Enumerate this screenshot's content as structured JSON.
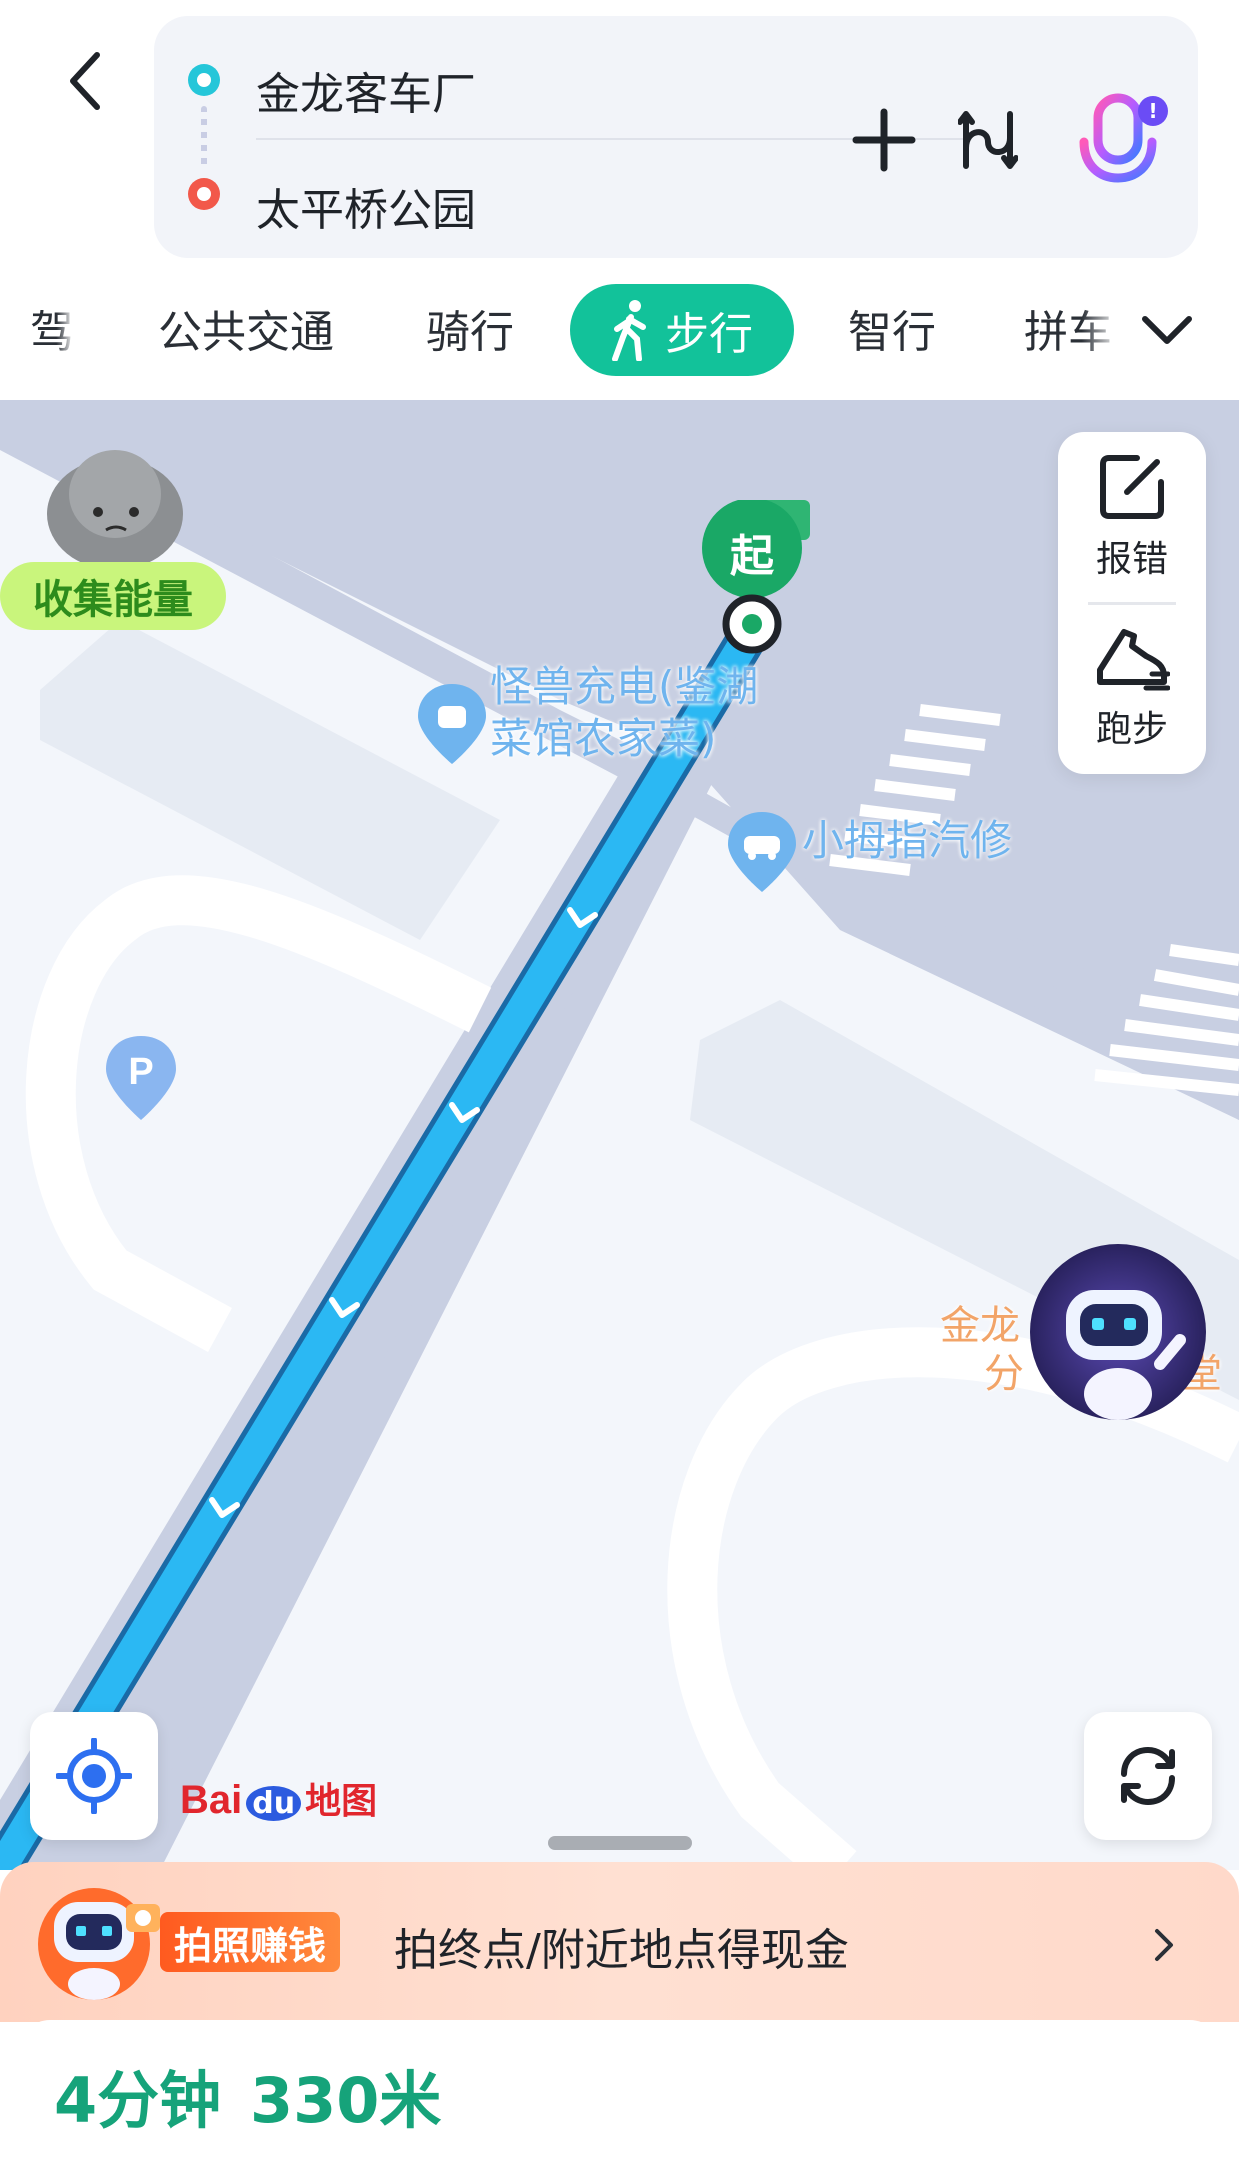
{
  "header": {
    "back_icon": "chevron-left-icon",
    "start_location": "金龙客车厂",
    "end_location": "太平桥公园",
    "add_waypoint_icon": "plus-icon",
    "swap_icon": "swap-route-icon",
    "voice_icon": "microphone-icon",
    "voice_badge": "!"
  },
  "tabs": {
    "items": [
      "驾",
      "公共交通",
      "骑行",
      "步行",
      "智行",
      "拼车"
    ],
    "active_index": 3,
    "active_icon": "walking-person-icon",
    "more_icon": "chevron-down-icon"
  },
  "map": {
    "energy_label": "收集能量",
    "start_marker": "起",
    "poi_charging": "怪兽充电(鉴湖\n菜馆农家菜)",
    "poi_charging_line1": "怪兽充电(鉴湖",
    "poi_charging_line2": "菜馆农家菜)",
    "poi_car_repair": "小拇指汽修",
    "poi_partial_line1": "金龙",
    "poi_partial_line2": "分",
    "poi_partial_right1": "",
    "poi_partial_right2": "堂",
    "side_panel": {
      "report_error": "报错",
      "run": "跑步"
    },
    "logo": {
      "part1": "Bai",
      "part2": "du",
      "part3": "地图"
    },
    "colors": {
      "route": "#2bb8f3",
      "route_edge": "#1a6aa6",
      "road": "#c6cde1",
      "start_green": "#15a66f"
    }
  },
  "promo": {
    "tag": "拍照赚钱",
    "text": "拍终点/附近地点得现金"
  },
  "summary": {
    "duration": "4分钟",
    "distance": "330米",
    "accent": "#16a37a"
  }
}
